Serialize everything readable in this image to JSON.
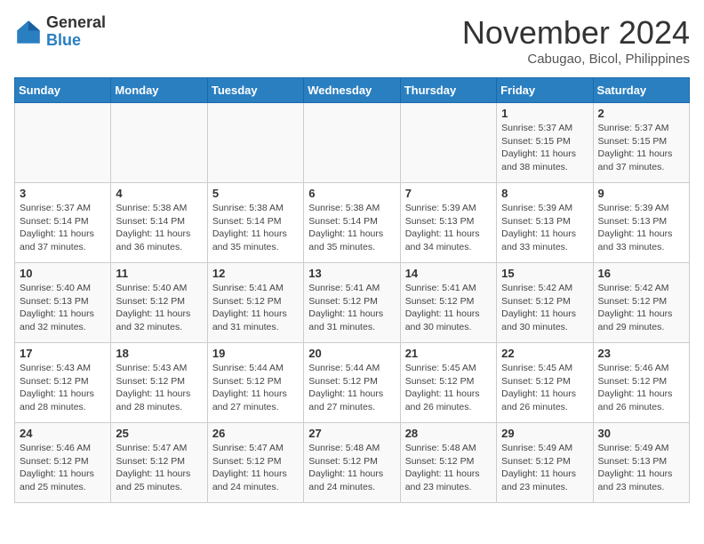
{
  "header": {
    "logo_general": "General",
    "logo_blue": "Blue",
    "month_title": "November 2024",
    "subtitle": "Cabugao, Bicol, Philippines"
  },
  "days_of_week": [
    "Sunday",
    "Monday",
    "Tuesday",
    "Wednesday",
    "Thursday",
    "Friday",
    "Saturday"
  ],
  "weeks": [
    [
      {
        "day": "",
        "info": ""
      },
      {
        "day": "",
        "info": ""
      },
      {
        "day": "",
        "info": ""
      },
      {
        "day": "",
        "info": ""
      },
      {
        "day": "",
        "info": ""
      },
      {
        "day": "1",
        "info": "Sunrise: 5:37 AM\nSunset: 5:15 PM\nDaylight: 11 hours and 38 minutes."
      },
      {
        "day": "2",
        "info": "Sunrise: 5:37 AM\nSunset: 5:15 PM\nDaylight: 11 hours and 37 minutes."
      }
    ],
    [
      {
        "day": "3",
        "info": "Sunrise: 5:37 AM\nSunset: 5:14 PM\nDaylight: 11 hours and 37 minutes."
      },
      {
        "day": "4",
        "info": "Sunrise: 5:38 AM\nSunset: 5:14 PM\nDaylight: 11 hours and 36 minutes."
      },
      {
        "day": "5",
        "info": "Sunrise: 5:38 AM\nSunset: 5:14 PM\nDaylight: 11 hours and 35 minutes."
      },
      {
        "day": "6",
        "info": "Sunrise: 5:38 AM\nSunset: 5:14 PM\nDaylight: 11 hours and 35 minutes."
      },
      {
        "day": "7",
        "info": "Sunrise: 5:39 AM\nSunset: 5:13 PM\nDaylight: 11 hours and 34 minutes."
      },
      {
        "day": "8",
        "info": "Sunrise: 5:39 AM\nSunset: 5:13 PM\nDaylight: 11 hours and 33 minutes."
      },
      {
        "day": "9",
        "info": "Sunrise: 5:39 AM\nSunset: 5:13 PM\nDaylight: 11 hours and 33 minutes."
      }
    ],
    [
      {
        "day": "10",
        "info": "Sunrise: 5:40 AM\nSunset: 5:13 PM\nDaylight: 11 hours and 32 minutes."
      },
      {
        "day": "11",
        "info": "Sunrise: 5:40 AM\nSunset: 5:12 PM\nDaylight: 11 hours and 32 minutes."
      },
      {
        "day": "12",
        "info": "Sunrise: 5:41 AM\nSunset: 5:12 PM\nDaylight: 11 hours and 31 minutes."
      },
      {
        "day": "13",
        "info": "Sunrise: 5:41 AM\nSunset: 5:12 PM\nDaylight: 11 hours and 31 minutes."
      },
      {
        "day": "14",
        "info": "Sunrise: 5:41 AM\nSunset: 5:12 PM\nDaylight: 11 hours and 30 minutes."
      },
      {
        "day": "15",
        "info": "Sunrise: 5:42 AM\nSunset: 5:12 PM\nDaylight: 11 hours and 30 minutes."
      },
      {
        "day": "16",
        "info": "Sunrise: 5:42 AM\nSunset: 5:12 PM\nDaylight: 11 hours and 29 minutes."
      }
    ],
    [
      {
        "day": "17",
        "info": "Sunrise: 5:43 AM\nSunset: 5:12 PM\nDaylight: 11 hours and 28 minutes."
      },
      {
        "day": "18",
        "info": "Sunrise: 5:43 AM\nSunset: 5:12 PM\nDaylight: 11 hours and 28 minutes."
      },
      {
        "day": "19",
        "info": "Sunrise: 5:44 AM\nSunset: 5:12 PM\nDaylight: 11 hours and 27 minutes."
      },
      {
        "day": "20",
        "info": "Sunrise: 5:44 AM\nSunset: 5:12 PM\nDaylight: 11 hours and 27 minutes."
      },
      {
        "day": "21",
        "info": "Sunrise: 5:45 AM\nSunset: 5:12 PM\nDaylight: 11 hours and 26 minutes."
      },
      {
        "day": "22",
        "info": "Sunrise: 5:45 AM\nSunset: 5:12 PM\nDaylight: 11 hours and 26 minutes."
      },
      {
        "day": "23",
        "info": "Sunrise: 5:46 AM\nSunset: 5:12 PM\nDaylight: 11 hours and 26 minutes."
      }
    ],
    [
      {
        "day": "24",
        "info": "Sunrise: 5:46 AM\nSunset: 5:12 PM\nDaylight: 11 hours and 25 minutes."
      },
      {
        "day": "25",
        "info": "Sunrise: 5:47 AM\nSunset: 5:12 PM\nDaylight: 11 hours and 25 minutes."
      },
      {
        "day": "26",
        "info": "Sunrise: 5:47 AM\nSunset: 5:12 PM\nDaylight: 11 hours and 24 minutes."
      },
      {
        "day": "27",
        "info": "Sunrise: 5:48 AM\nSunset: 5:12 PM\nDaylight: 11 hours and 24 minutes."
      },
      {
        "day": "28",
        "info": "Sunrise: 5:48 AM\nSunset: 5:12 PM\nDaylight: 11 hours and 23 minutes."
      },
      {
        "day": "29",
        "info": "Sunrise: 5:49 AM\nSunset: 5:12 PM\nDaylight: 11 hours and 23 minutes."
      },
      {
        "day": "30",
        "info": "Sunrise: 5:49 AM\nSunset: 5:13 PM\nDaylight: 11 hours and 23 minutes."
      }
    ]
  ]
}
